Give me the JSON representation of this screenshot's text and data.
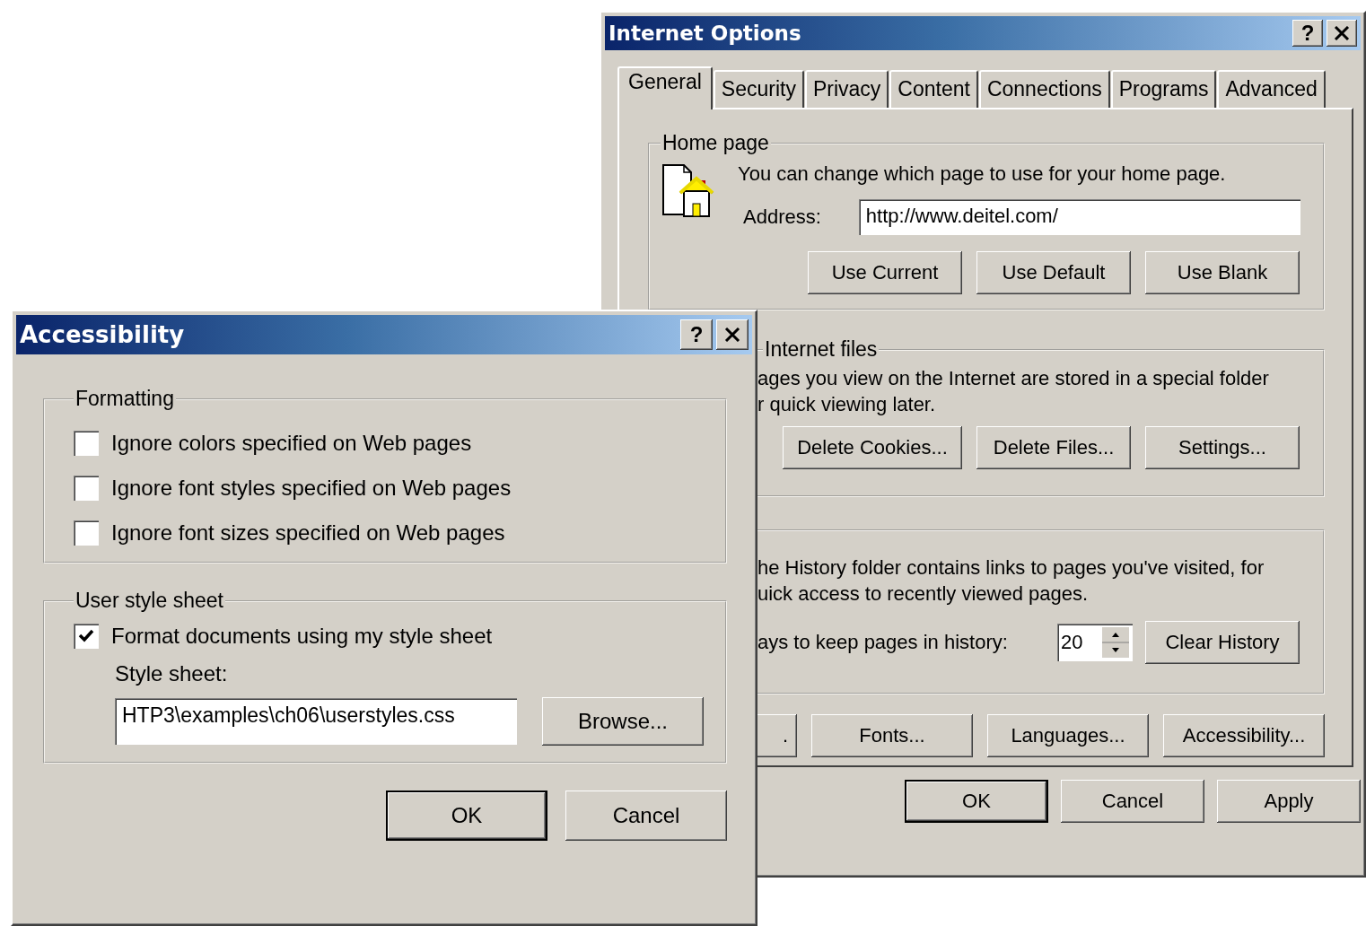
{
  "internet_options": {
    "title": "Internet Options",
    "help_button": "?",
    "tabs": [
      {
        "label": "General",
        "selected": true
      },
      {
        "label": "Security",
        "selected": false
      },
      {
        "label": "Privacy",
        "selected": false
      },
      {
        "label": "Content",
        "selected": false
      },
      {
        "label": "Connections",
        "selected": false
      },
      {
        "label": "Programs",
        "selected": false
      },
      {
        "label": "Advanced",
        "selected": false
      }
    ],
    "home_page": {
      "legend": "Home page",
      "description": "You can change which page to use for your home page.",
      "address_label": "Address:",
      "address_value": "http://www.deitel.com/",
      "buttons": [
        "Use Current",
        "Use Default",
        "Use Blank"
      ]
    },
    "internet_files": {
      "legend": "Internet files",
      "description_lines": [
        "ages you view on the Internet are stored in a special folder",
        "r quick viewing later."
      ],
      "buttons": [
        "Delete Cookies...",
        "Delete Files...",
        "Settings..."
      ]
    },
    "history": {
      "description_lines": [
        "he History folder contains links to pages you've visited, for",
        "uick access to recently viewed pages."
      ],
      "days_label": "ays to keep pages in history:",
      "days_value": "20",
      "button": "Clear History"
    },
    "bottom_buttons": [
      ".",
      "Fonts...",
      "Languages...",
      "Accessibility..."
    ],
    "dialog_buttons": [
      {
        "label": "OK",
        "default": true
      },
      {
        "label": "Cancel",
        "default": false
      },
      {
        "label": "Apply",
        "default": false
      }
    ]
  },
  "accessibility": {
    "title": "Accessibility",
    "help_button": "?",
    "formatting": {
      "legend": "Formatting",
      "options": [
        {
          "label": "Ignore colors specified on Web pages",
          "checked": false
        },
        {
          "label": "Ignore font styles specified on Web pages",
          "checked": false
        },
        {
          "label": "Ignore font sizes specified on Web pages",
          "checked": false
        }
      ]
    },
    "user_style_sheet": {
      "legend": "User style sheet",
      "options": [
        {
          "label": "Format documents using my style sheet",
          "checked": true
        }
      ],
      "style_sheet_label": "Style sheet:",
      "style_sheet_value": "HTP3\\examples\\ch06\\userstyles.css",
      "browse_button": "Browse..."
    },
    "dialog_buttons": [
      {
        "label": "OK",
        "default": true
      },
      {
        "label": "Cancel",
        "default": false
      }
    ]
  }
}
